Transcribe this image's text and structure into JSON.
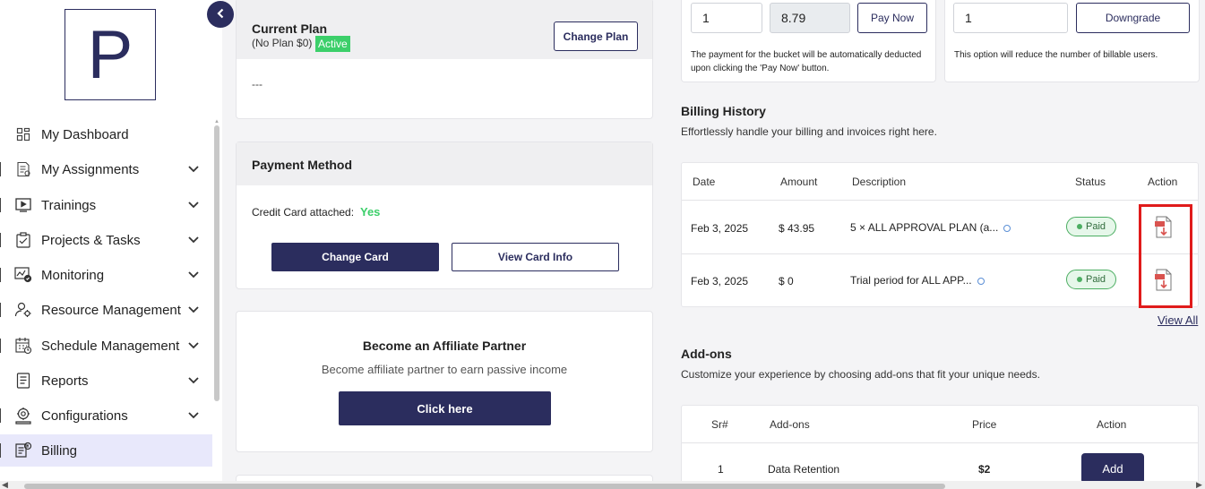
{
  "sidebar": {
    "logo_letter": "P",
    "items": [
      {
        "label": "My Dashboard",
        "icon": "dashboard-icon",
        "has_chevron": false
      },
      {
        "label": "My Assignments",
        "icon": "assignments-icon",
        "has_chevron": true
      },
      {
        "label": "Trainings",
        "icon": "play-icon",
        "has_chevron": true
      },
      {
        "label": "Projects & Tasks",
        "icon": "clipboard-icon",
        "has_chevron": true
      },
      {
        "label": "Monitoring",
        "icon": "monitoring-icon",
        "has_chevron": true
      },
      {
        "label": "Resource Management",
        "icon": "resource-icon",
        "has_chevron": true
      },
      {
        "label": "Schedule Management",
        "icon": "calendar-icon",
        "has_chevron": true
      },
      {
        "label": "Reports",
        "icon": "report-icon",
        "has_chevron": true
      },
      {
        "label": "Configurations",
        "icon": "config-icon",
        "has_chevron": true
      },
      {
        "label": "Billing",
        "icon": "billing-icon",
        "has_chevron": false,
        "active": true
      }
    ]
  },
  "current_plan": {
    "title": "Current Plan",
    "subtitle": "(No Plan $0)",
    "badge": "Active",
    "change_button": "Change Plan",
    "body": "---"
  },
  "payment_method": {
    "title": "Payment Method",
    "credit_label": "Credit Card attached:",
    "credit_value": "Yes",
    "change_card": "Change Card",
    "view_card": "View Card Info"
  },
  "affiliate": {
    "title": "Become an Affiliate Partner",
    "subtitle": "Become affiliate partner to earn passive income",
    "button": "Click here"
  },
  "bucket": {
    "qty_value": "1",
    "price_value": "8.79",
    "pay_button": "Pay Now",
    "note": "The payment for the bucket will be automatically deducted upon clicking the 'Pay Now' button."
  },
  "downgrade": {
    "qty_value": "1",
    "button": "Downgrade",
    "note": "This option will reduce the number of billable users."
  },
  "billing_history": {
    "title": "Billing History",
    "subtitle": "Effortlessly handle your billing and invoices right here.",
    "headers": {
      "date": "Date",
      "amount": "Amount",
      "description": "Description",
      "status": "Status",
      "action": "Action"
    },
    "rows": [
      {
        "date": "Feb 3, 2025",
        "amount": "$ 43.95",
        "description": "5 × ALL APPROVAL PLAN (a...",
        "status": "Paid"
      },
      {
        "date": "Feb 3, 2025",
        "amount": "$ 0",
        "description": "Trial period for ALL APP...",
        "status": "Paid"
      }
    ],
    "view_all": "View All"
  },
  "addons": {
    "title": "Add-ons",
    "subtitle": "Customize your experience by choosing add-ons that fit your unique needs.",
    "headers": {
      "sr": "Sr#",
      "name": "Add-ons",
      "price": "Price",
      "action": "Action"
    },
    "rows": [
      {
        "sr": "1",
        "name": "Data Retention",
        "price": "$2",
        "action": "Add"
      }
    ]
  },
  "colors": {
    "primary": "#2b2d5e",
    "active_badge": "#3ccf6a",
    "yes_text": "#3ccf6a",
    "highlight": "#e01b1b",
    "sidebar_active_bg": "#e8e8fb"
  }
}
